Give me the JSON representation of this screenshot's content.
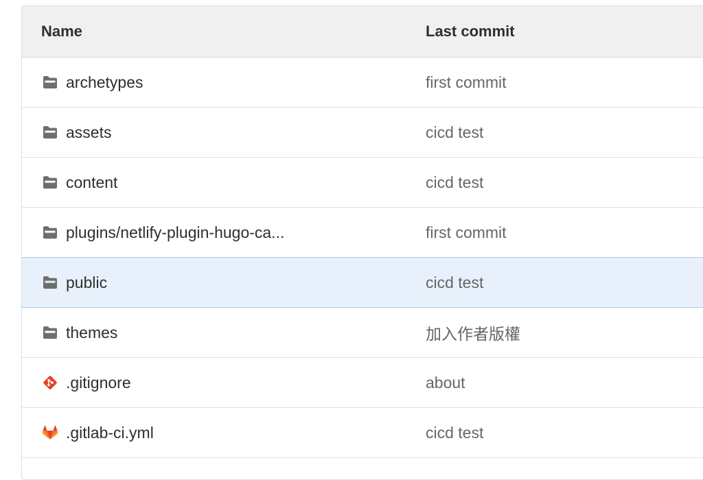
{
  "header": {
    "name_label": "Name",
    "last_commit_label": "Last commit"
  },
  "rows": [
    {
      "name": "archetypes",
      "commit": "first commit",
      "icon": "folder-icon"
    },
    {
      "name": "assets",
      "commit": "cicd test",
      "icon": "folder-icon"
    },
    {
      "name": "content",
      "commit": "cicd test",
      "icon": "folder-icon"
    },
    {
      "name": "plugins/netlify-plugin-hugo-ca...",
      "commit": "first commit",
      "icon": "folder-icon"
    },
    {
      "name": "public",
      "commit": "cicd test",
      "icon": "folder-icon",
      "selected": true
    },
    {
      "name": "themes",
      "commit": "加入作者版權",
      "icon": "folder-icon"
    },
    {
      "name": ".gitignore",
      "commit": "about",
      "icon": "git-icon"
    },
    {
      "name": ".gitlab-ci.yml",
      "commit": "cicd test",
      "icon": "gitlab-icon"
    }
  ],
  "colors": {
    "header_bg": "#f0f0f0",
    "selected_bg": "#e8f1fb",
    "selected_border": "#a9cbe9",
    "folder_icon": "#6e6e6e",
    "git_icon": "#e24329",
    "gitlab_orange": "#fc6d26"
  }
}
